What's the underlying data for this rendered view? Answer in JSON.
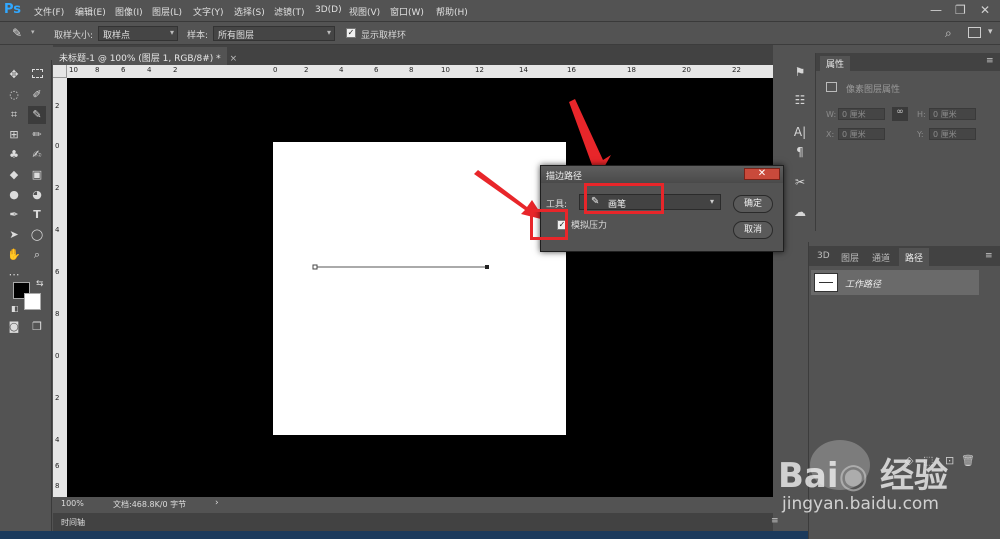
{
  "app": {
    "logo": "Ps",
    "menu": [
      "文件(F)",
      "编辑(E)",
      "图像(I)",
      "图层(L)",
      "文字(Y)",
      "选择(S)",
      "滤镜(T)",
      "3D(D)",
      "视图(V)",
      "窗口(W)",
      "帮助(H)"
    ],
    "window_controls": [
      "—",
      "❐",
      "✕"
    ]
  },
  "options_bar": {
    "sample_size_label": "取样大小:",
    "sample_size_value": "取样点",
    "sample_label": "样本:",
    "sample_value": "所有图层",
    "show_ring_label": "显示取样环",
    "show_ring_checked": true
  },
  "document": {
    "tab_title": "未标题-1 @ 100% (图层 1, RGB/8#) *",
    "ruler_top": [
      "10",
      "8",
      "6",
      "4",
      "2",
      "0",
      "2",
      "4",
      "6",
      "8",
      "10",
      "12",
      "14",
      "16",
      "18",
      "20",
      "22"
    ],
    "ruler_left": [
      "2",
      "0",
      "2",
      "4",
      "6",
      "8",
      "0",
      "2",
      "4",
      "6",
      "8"
    ],
    "zoom": "100%",
    "doc_info": "文档:468.8K/0 字节"
  },
  "timeline": {
    "label": "时间轴"
  },
  "properties": {
    "tab": "属性",
    "subtitle": "像素图层属性",
    "w_label": "W:",
    "w_value": "0 厘米",
    "h_label": "H:",
    "h_value": "0 厘米",
    "x_label": "X:",
    "x_value": "0 厘米",
    "y_label": "Y:",
    "y_value": "0 厘米"
  },
  "layers_panel": {
    "tabs": [
      "3D",
      "图层",
      "通道",
      "路径"
    ],
    "active_tab": "路径",
    "path_item": "工作路径"
  },
  "dialog": {
    "title": "描边路径",
    "tool_label": "工具:",
    "tool_value": "画笔",
    "simulate_pressure_label": "模拟压力",
    "simulate_pressure_checked": true,
    "ok_label": "确定",
    "cancel_label": "取消"
  },
  "colors": {
    "accent": "#31a8ff",
    "annotation": "#e8262a",
    "panel_bg": "#535353",
    "canvas_bg": "#000000"
  }
}
